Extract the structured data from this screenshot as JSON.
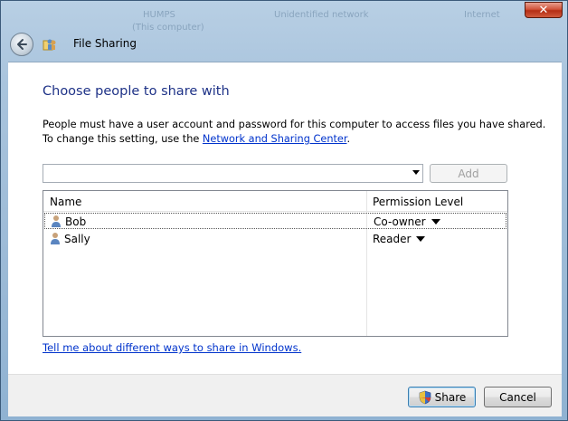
{
  "window": {
    "title": "File Sharing",
    "close_label": "✕",
    "background_labels": [
      "HUMPS",
      "(This computer)",
      "Unidentified network",
      "Internet"
    ]
  },
  "main": {
    "heading": "Choose people to share with",
    "description_text": "People must have a user account and password for this computer to access files you have shared.  To change this setting, use the ",
    "description_link": "Network and Sharing Center",
    "description_end": ".",
    "user_input": {
      "value": "",
      "placeholder": ""
    },
    "add_button": "Add",
    "columns": {
      "name": "Name",
      "permission": "Permission Level"
    },
    "rows": [
      {
        "name": "Bob",
        "permission": "Co-owner"
      },
      {
        "name": "Sally",
        "permission": "Reader"
      }
    ],
    "help_link": "Tell me about different ways to share in Windows."
  },
  "footer": {
    "share_button": "Share",
    "cancel_button": "Cancel"
  },
  "colors": {
    "heading": "#1e3287",
    "link": "#0033cc",
    "close_button": "#c8432a"
  },
  "icons": [
    "back-arrow-icon",
    "file-sharing-icon",
    "user-icon",
    "shield-icon",
    "dropdown-arrow-icon"
  ]
}
